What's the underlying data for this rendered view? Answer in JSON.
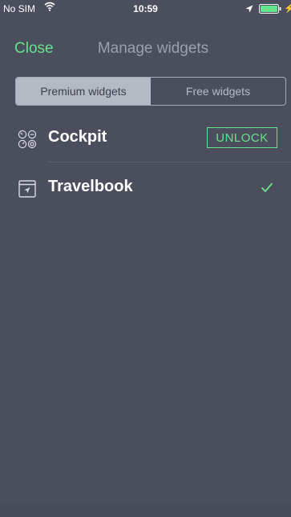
{
  "status_bar": {
    "carrier": "No SIM",
    "time": "10:59",
    "wifi_icon": "wifi-icon",
    "location_icon": "location-arrow-icon",
    "battery_icon": "battery-icon",
    "charging_icon": "charging-bolt-icon",
    "charging_glyph": "⚡"
  },
  "nav": {
    "close_label": "Close",
    "title": "Manage widgets"
  },
  "segments": {
    "premium_label": "Premium widgets",
    "free_label": "Free widgets",
    "selected": "Premium widgets"
  },
  "widgets": [
    {
      "name": "Cockpit",
      "icon": "cockpit-gauges-icon",
      "action_label": "UNLOCK"
    },
    {
      "name": "Travelbook",
      "icon": "travelbook-icon",
      "status_icon": "checkmark-icon"
    }
  ],
  "colors": {
    "accent": "#66e38c",
    "background": "#4a4e5d",
    "segment_active": "#b5b9c4"
  }
}
